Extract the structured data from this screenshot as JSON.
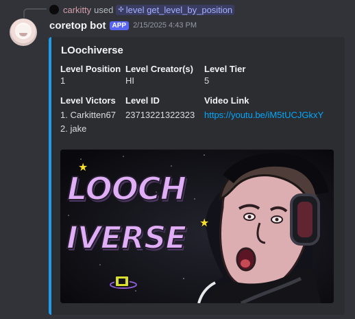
{
  "reply": {
    "username": "carkitty",
    "used_text": "used",
    "command": "level get_level_by_position"
  },
  "message": {
    "author": "coretop bot",
    "badge": "APP",
    "timestamp": "2/15/2025 4:43 PM"
  },
  "embed": {
    "accent_color": "#1e9be9",
    "title": "LOochiverse",
    "fields": [
      {
        "name": "Level Position",
        "value": "1"
      },
      {
        "name": "Level Creator(s)",
        "value": "HI"
      },
      {
        "name": "Level Tier",
        "value": "5"
      },
      {
        "name": "Level Victors",
        "value_lines": [
          "1. Carkitten67",
          "2. jake"
        ]
      },
      {
        "name": "Level ID",
        "value": "23713221322323"
      },
      {
        "name": "Video Link",
        "value": "https://youtu.be/iM5tUCJGkxY"
      }
    ],
    "image": {
      "logo_lines": [
        "LOOCH",
        "IVERSE"
      ]
    }
  }
}
